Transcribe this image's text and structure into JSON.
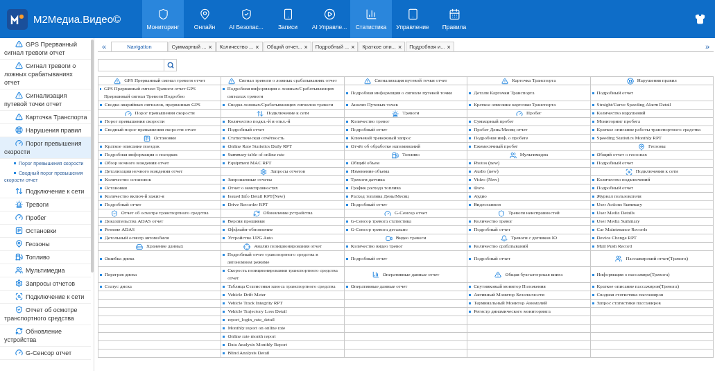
{
  "app": {
    "title": "M2Медиа.Видео©"
  },
  "nav": [
    {
      "label": "Мониторинг",
      "selected": true
    },
    {
      "label": "Онлайн",
      "selected": false
    },
    {
      "label": "AI Безопас...",
      "selected": false
    },
    {
      "label": "Записи",
      "selected": false
    },
    {
      "label": "AI Управле...",
      "selected": false
    },
    {
      "label": "Статистика",
      "selected": true
    },
    {
      "label": "Управление",
      "selected": false
    },
    {
      "label": "Правила",
      "selected": false
    }
  ],
  "sidebar": {
    "items": [
      {
        "label": "GPS Прерванный сигнал тревоги отчет",
        "selected": false
      },
      {
        "label": "Сигнал тревоги о ложных срабатываниях отчет",
        "selected": false
      },
      {
        "label": "Сигнализация путевой точки отчет",
        "selected": false
      },
      {
        "label": "Карточка Транспорта",
        "selected": false
      },
      {
        "label": "Нарушения правил",
        "selected": false
      },
      {
        "label": "Порог превышения скорости",
        "selected": true,
        "children": [
          {
            "label": "Порог превышения скорости"
          },
          {
            "label": "Сводный порог превышения скорости отчет"
          }
        ]
      },
      {
        "label": "Подключение к сети",
        "selected": false
      },
      {
        "label": "Тревоги",
        "selected": false
      },
      {
        "label": "Пробег",
        "selected": false
      },
      {
        "label": "Остановки",
        "selected": false
      },
      {
        "label": "Геозоны",
        "selected": false
      },
      {
        "label": "Топливо",
        "selected": false
      },
      {
        "label": "Мультимедиа",
        "selected": false
      },
      {
        "label": "Запросы отчетов",
        "selected": false
      },
      {
        "label": "Подключение к сети",
        "selected": false
      },
      {
        "label": "Отчет об осмотре транспортного средства",
        "selected": false
      },
      {
        "label": "Обновление устройства",
        "selected": false
      },
      {
        "label": "G-Сенсор отчет",
        "selected": false
      }
    ]
  },
  "tabs": {
    "prev": "«",
    "next": "»",
    "items": [
      {
        "label": "Navigation",
        "selected": true
      },
      {
        "label": "Суммарный ...",
        "selected": false,
        "close": "×"
      },
      {
        "label": "Количество ...",
        "selected": false,
        "close": "×"
      },
      {
        "label": "Общий отчет...",
        "selected": false,
        "close": "×"
      },
      {
        "label": "Подробный ...",
        "selected": false,
        "close": "×"
      },
      {
        "label": "Краткое опи...",
        "selected": false,
        "close": "×"
      },
      {
        "label": "Подробная и...",
        "selected": false,
        "close": "×"
      }
    ]
  },
  "report_grid": {
    "columns": [
      [
        {
          "kind": "header",
          "text": "GPS Прерванный сигнал тревоги отчет"
        },
        {
          "kind": "item",
          "text": "GPS Прерванный сигнал Тревоги отчет GPS Прерванный сигнал Тревоги Подробно"
        },
        {
          "kind": "item",
          "text": "Сводка аварийных сигналов, прерванных GPS"
        },
        {
          "kind": "header",
          "text": "Порог превышения скорости"
        },
        {
          "kind": "item",
          "text": "Порог превышения скорости"
        },
        {
          "kind": "item",
          "text": "Сводный порог превышения скорости отчет"
        },
        {
          "kind": "header",
          "text": "Остановки"
        },
        {
          "kind": "item",
          "text": "Краткое описание поездок"
        },
        {
          "kind": "item",
          "text": "Подробная информация о поездках"
        },
        {
          "kind": "item",
          "text": "Обзор ночного вождения отчет"
        },
        {
          "kind": "item",
          "text": "Детализация ночного вождения отчет"
        },
        {
          "kind": "item",
          "text": "Количество остановок"
        },
        {
          "kind": "item",
          "text": "Остановки"
        },
        {
          "kind": "item",
          "text": "Количество включ-й зажиг-я"
        },
        {
          "kind": "item",
          "text": "Подробный отчет"
        },
        {
          "kind": "header",
          "text": "Отчет об осмотре транспортного средства"
        },
        {
          "kind": "item",
          "text": "Доказательства ADAS отчет"
        },
        {
          "kind": "item",
          "text": "Резюме ADAS"
        },
        {
          "kind": "item",
          "text": "Детальный осмотр автомобиля"
        },
        {
          "kind": "header",
          "text": "Хранение данных"
        },
        {
          "kind": "item",
          "text": "Ошибка диска"
        },
        {
          "kind": "item",
          "text": "Перегрев диска"
        },
        {
          "kind": "item",
          "text": "Статус диска"
        }
      ],
      [
        {
          "kind": "header",
          "text": "Сигнал тревоги о ложных срабатываниях отчет"
        },
        {
          "kind": "item",
          "text": "Подробная информация о ложных/Срабатывающих сигналах тревоги"
        },
        {
          "kind": "item",
          "text": "Сводка ложных/Срабатывающих сигналов тревоги"
        },
        {
          "kind": "header",
          "text": "Подключение к сети"
        },
        {
          "kind": "item",
          "text": "Количество подкл.-й и откл.-й"
        },
        {
          "kind": "item",
          "text": "Подробный отчет"
        },
        {
          "kind": "item",
          "text": "Статистическая отчётность"
        },
        {
          "kind": "item",
          "text": "Online Rate Statistics Daily RPT"
        },
        {
          "kind": "item",
          "text": "Summary table of online rate"
        },
        {
          "kind": "item",
          "text": "Equipment MAC RPT"
        },
        {
          "kind": "header",
          "text": "Запросы отчетов"
        },
        {
          "kind": "item",
          "text": "Запрошенные отчеты"
        },
        {
          "kind": "item",
          "text": "Отчет о неисправностях"
        },
        {
          "kind": "item",
          "text": "Issued Info Detail RPT(New)"
        },
        {
          "kind": "item",
          "text": "Drive Recorder RPT"
        },
        {
          "kind": "header",
          "text": "Обновление устройства"
        },
        {
          "kind": "item",
          "text": "Версия прошивки"
        },
        {
          "kind": "item",
          "text": "Оффлайн-обновление"
        },
        {
          "kind": "item",
          "text": "Устройство UPG Auto"
        },
        {
          "kind": "header",
          "text": "Анализ позиционирования отчет"
        },
        {
          "kind": "item",
          "text": "Подробный отчет транспортного средства в автономном режиме"
        },
        {
          "kind": "item",
          "text": "Скорость позиционирования транспортного средства отчет"
        },
        {
          "kind": "item",
          "text": "Таблица Статистики заноса транспортного средства"
        },
        {
          "kind": "item",
          "text": "Vehicle Drift Meter"
        },
        {
          "kind": "item",
          "text": "Vehicle Track Integrity RPT"
        },
        {
          "kind": "item",
          "text": "Vehicle Trajectory Loss Detail"
        },
        {
          "kind": "item",
          "text": "report_login_rate_detail"
        },
        {
          "kind": "item",
          "text": "Monthly report on online rate"
        },
        {
          "kind": "item",
          "text": "Online rate month report"
        },
        {
          "kind": "item",
          "text": "Data Analysis Monthly Report"
        },
        {
          "kind": "item",
          "text": "Blind Analysis Detail"
        }
      ],
      [
        {
          "kind": "header",
          "text": "Сигнализация путевой точки отчет"
        },
        {
          "kind": "item",
          "text": "Подробная информация о сигнале путевой точки"
        },
        {
          "kind": "item",
          "text": "Анализ Путевых точек"
        },
        {
          "kind": "header",
          "text": "Тревоги"
        },
        {
          "kind": "item",
          "text": "Количество тревог"
        },
        {
          "kind": "item",
          "text": "Подробный отчет"
        },
        {
          "kind": "item",
          "text": "Ключевой тревожный запрос"
        },
        {
          "kind": "item",
          "text": "Отчёт об обработке напоминаний"
        },
        {
          "kind": "header",
          "text": "Топливо"
        },
        {
          "kind": "item",
          "text": "Общий объем"
        },
        {
          "kind": "item",
          "text": "Изменение объема"
        },
        {
          "kind": "item",
          "text": "Тревоги датчика"
        },
        {
          "kind": "item",
          "text": "График расхода топлива"
        },
        {
          "kind": "item",
          "text": "Расход топлива День/Месяц"
        },
        {
          "kind": "item",
          "text": "Подробный отчет"
        },
        {
          "kind": "header",
          "text": "G-Сенсор отчет"
        },
        {
          "kind": "item",
          "text": "G-Сенсор тревога статистика"
        },
        {
          "kind": "item",
          "text": "G-Сенсор тревога детально"
        },
        {
          "kind": "header",
          "text": "Видео тревоги"
        },
        {
          "kind": "item",
          "text": "Количество видео тревог"
        },
        {
          "kind": "item",
          "text": "Подробный отчет"
        },
        {
          "kind": "header",
          "text": "Оперативные данные отчет"
        },
        {
          "kind": "item",
          "text": "Оперативные данные отчет"
        }
      ],
      [
        {
          "kind": "header",
          "text": "Карточка Транспорта"
        },
        {
          "kind": "item",
          "text": "Детали Карточки Транспорта"
        },
        {
          "kind": "item",
          "text": "Краткое описание карточки Транспорта"
        },
        {
          "kind": "header",
          "text": "Пробег"
        },
        {
          "kind": "item",
          "text": "Суммарный пробег"
        },
        {
          "kind": "item",
          "text": "Пробег День/Месяц отчет"
        },
        {
          "kind": "item",
          "text": "Подробная инф. о пробеге"
        },
        {
          "kind": "item",
          "text": "Ежемесячный пробег"
        },
        {
          "kind": "header",
          "text": "Мультимедиа"
        },
        {
          "kind": "item",
          "text": "Photos (new)"
        },
        {
          "kind": "item",
          "text": "Audio (new)"
        },
        {
          "kind": "item",
          "text": "Video (New)"
        },
        {
          "kind": "item",
          "text": "Фото"
        },
        {
          "kind": "item",
          "text": "Аудио"
        },
        {
          "kind": "item",
          "text": "Видеозаписи"
        },
        {
          "kind": "header",
          "text": "Тревоги неисправностей"
        },
        {
          "kind": "item",
          "text": "Количество тревог"
        },
        {
          "kind": "item",
          "text": "Подробный отчет"
        },
        {
          "kind": "header",
          "text": "Тревоги с датчиков IO"
        },
        {
          "kind": "item",
          "text": "Количество срабатываний"
        },
        {
          "kind": "item",
          "text": "Подробный отчет"
        },
        {
          "kind": "header",
          "text": "Общая бухгалтерская книга"
        },
        {
          "kind": "item",
          "text": "Спутниковый монитор Положения"
        },
        {
          "kind": "item",
          "text": "Активный Монитор Безопасности"
        },
        {
          "kind": "item",
          "text": "Терминальный Монитор Аномалий"
        },
        {
          "kind": "item",
          "text": "Регистр динамического мониторинга"
        }
      ],
      [
        {
          "kind": "header",
          "text": "Нарушения правил"
        },
        {
          "kind": "item",
          "text": "Подробный отчет"
        },
        {
          "kind": "item",
          "text": "Straight/Curve Speeding Alarm Detail"
        },
        {
          "kind": "item",
          "text": "Количество нарушений"
        },
        {
          "kind": "item",
          "text": "Мониторинг пробега"
        },
        {
          "kind": "item",
          "text": "Краткое описание работы транспортного средства"
        },
        {
          "kind": "item",
          "text": "Speeding Statistics Monthly RPT"
        },
        {
          "kind": "header",
          "text": "Геозоны"
        },
        {
          "kind": "item",
          "text": "Общий отчет о геозонах"
        },
        {
          "kind": "item",
          "text": "Подробный отчет"
        },
        {
          "kind": "header",
          "text": "Подключения к сети"
        },
        {
          "kind": "item",
          "text": "Количество подключений"
        },
        {
          "kind": "item",
          "text": "Подробный отчет"
        },
        {
          "kind": "item",
          "text": "Журнал пользователя"
        },
        {
          "kind": "item",
          "text": "User Actions Summary"
        },
        {
          "kind": "item",
          "text": "User Media Details"
        },
        {
          "kind": "item",
          "text": "User Media Summary"
        },
        {
          "kind": "item",
          "text": "Car Maintenance Records"
        },
        {
          "kind": "item",
          "text": "Device Change RPT"
        },
        {
          "kind": "item",
          "text": "Mail Push Record"
        },
        {
          "kind": "header",
          "text": "Пассажирский отчет(Тревога)"
        },
        {
          "kind": "item",
          "text": "Информация о пассажире(Тревога)"
        },
        {
          "kind": "item",
          "text": "Краткое описание пассажиров(Тревога)"
        },
        {
          "kind": "item",
          "text": "Сводная статистика пассажиров"
        },
        {
          "kind": "item",
          "text": "Запрос статистики пассажиров"
        }
      ]
    ]
  }
}
